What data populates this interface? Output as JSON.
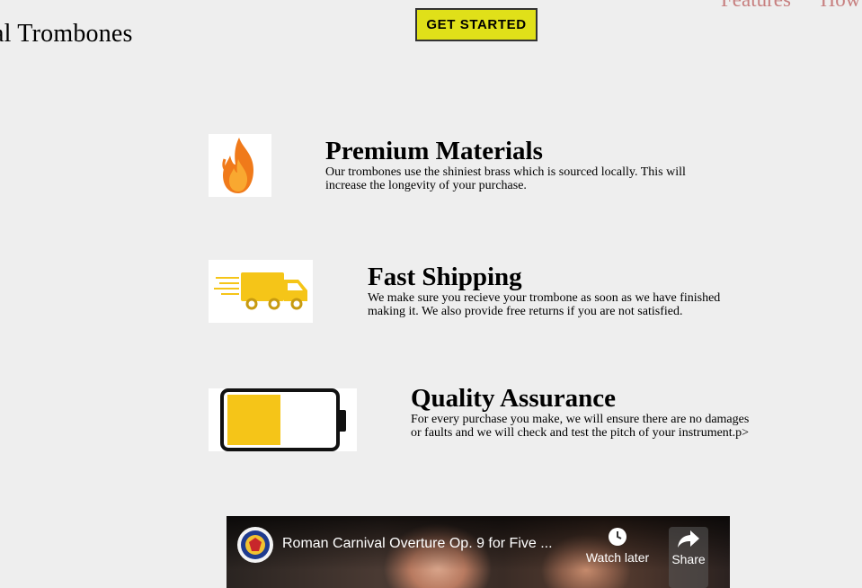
{
  "header": {
    "brand": "al Trombones",
    "cta_label": "GET STARTED",
    "nav": [
      "Features",
      "How"
    ]
  },
  "features": [
    {
      "icon": "fire-icon",
      "title": "Premium Materials",
      "description": "Our trombones use the shiniest brass which is sourced locally. This will increase the longevity of your purchase."
    },
    {
      "icon": "delivery-truck-icon",
      "title": "Fast Shipping",
      "description": "We make sure you recieve your trombone as soon as we have finished making it. We also provide free returns if you are not satisfied."
    },
    {
      "icon": "battery-icon",
      "title": "Quality Assurance",
      "description": "For every purchase you make, we will ensure there are no damages or faults and we will check and test the pitch of your instrument.p>"
    }
  ],
  "video": {
    "title": "Roman Carnival Overture Op. 9 for Five ...",
    "watch_later": "Watch later",
    "share": "Share"
  },
  "colors": {
    "background": "#eeeeee",
    "cta_background": "#e0e019",
    "nav_link": "#c77f7f",
    "icon_yellow": "#f5c518"
  }
}
